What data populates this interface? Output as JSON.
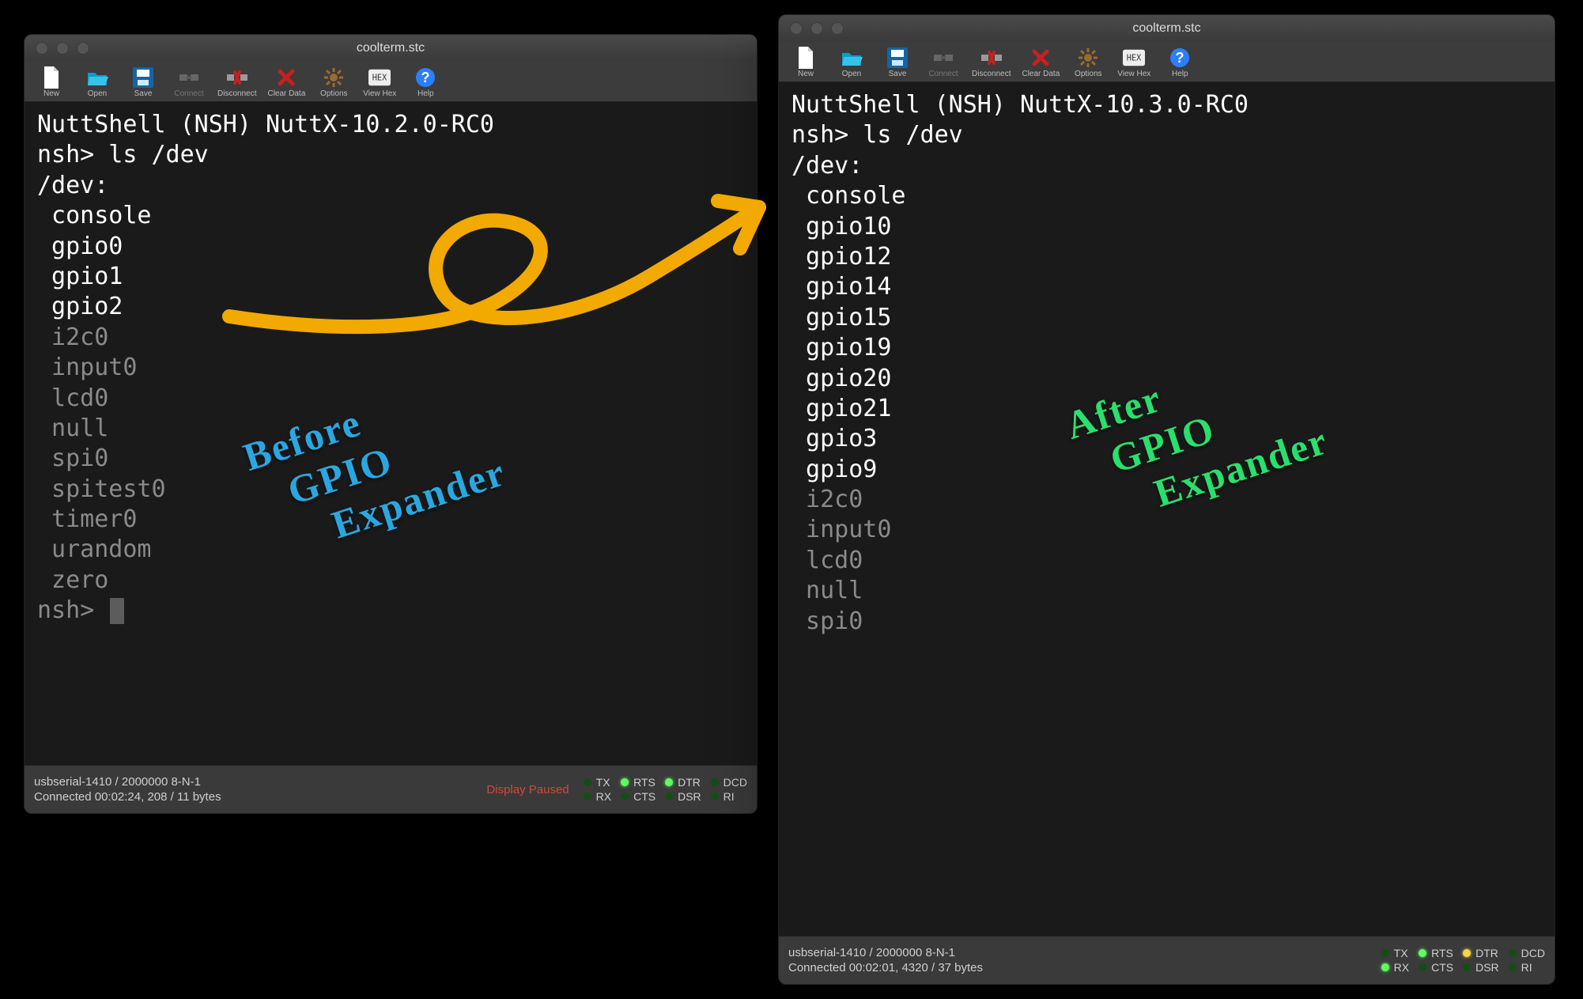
{
  "background": "#000000",
  "windows": {
    "left": {
      "title": "coolterm.stc",
      "toolbar": [
        {
          "id": "new",
          "label": "New"
        },
        {
          "id": "open",
          "label": "Open"
        },
        {
          "id": "save",
          "label": "Save"
        },
        {
          "id": "connect",
          "label": "Connect",
          "disabled": true
        },
        {
          "id": "disconnect",
          "label": "Disconnect"
        },
        {
          "id": "clear",
          "label": "Clear Data"
        },
        {
          "id": "options",
          "label": "Options"
        },
        {
          "id": "viewhex",
          "label": "View Hex"
        },
        {
          "id": "help",
          "label": "Help"
        }
      ],
      "terminal": {
        "banner": "NuttShell (NSH) NuttX-10.2.0-RC0",
        "prompt": "nsh> ",
        "command": "ls /dev",
        "dirHeader": "/dev:",
        "entries_bright": [
          "console",
          "gpio0",
          "gpio1",
          "gpio2"
        ],
        "entries_dim": [
          "i2c0",
          "input0",
          "lcd0",
          "null",
          "spi0",
          "spitest0",
          "timer0",
          "urandom",
          "zero"
        ],
        "trailing_prompt": true
      },
      "status": {
        "port": "usbserial-1410 / 2000000 8-N-1",
        "state": "Connected 00:02:24, 208 / 11 bytes",
        "paused": "Display Paused",
        "leds": {
          "TX": "off",
          "RX": "off",
          "RTS": "on",
          "CTS": "off",
          "DTR": "on",
          "DSR": "off",
          "DCD": "off",
          "RI": "off"
        }
      }
    },
    "right": {
      "title": "coolterm.stc",
      "toolbar": [
        {
          "id": "new",
          "label": "New"
        },
        {
          "id": "open",
          "label": "Open"
        },
        {
          "id": "save",
          "label": "Save"
        },
        {
          "id": "connect",
          "label": "Connect",
          "disabled": true
        },
        {
          "id": "disconnect",
          "label": "Disconnect"
        },
        {
          "id": "clear",
          "label": "Clear Data"
        },
        {
          "id": "options",
          "label": "Options"
        },
        {
          "id": "viewhex",
          "label": "View Hex"
        },
        {
          "id": "help",
          "label": "Help"
        }
      ],
      "terminal": {
        "banner": "NuttShell (NSH) NuttX-10.3.0-RC0",
        "prompt": "nsh> ",
        "command": "ls /dev",
        "dirHeader": "/dev:",
        "entries_bright": [
          "console",
          "gpio10",
          "gpio12",
          "gpio14",
          "gpio15",
          "gpio19",
          "gpio20",
          "gpio21",
          "gpio3",
          "gpio9"
        ],
        "entries_dim": [
          "i2c0",
          "input0",
          "lcd0",
          "null",
          "spi0"
        ],
        "trailing_prompt": false
      },
      "status": {
        "port": "usbserial-1410 / 2000000 8-N-1",
        "state": "Connected 00:02:01, 4320 / 37 bytes",
        "paused": "",
        "leds": {
          "TX": "off",
          "RX": "on",
          "RTS": "on",
          "CTS": "off",
          "DTR": "yellow",
          "DSR": "off",
          "DCD": "off",
          "RI": "off"
        }
      }
    }
  },
  "annotations": {
    "before": {
      "lines": [
        "Before",
        "GPIO",
        "Expander"
      ],
      "color": "#2aa7e0"
    },
    "after": {
      "lines": [
        "After",
        "GPIO",
        "Expander"
      ],
      "color": "#2adf6e"
    },
    "arrow_color": "#f2a900"
  }
}
